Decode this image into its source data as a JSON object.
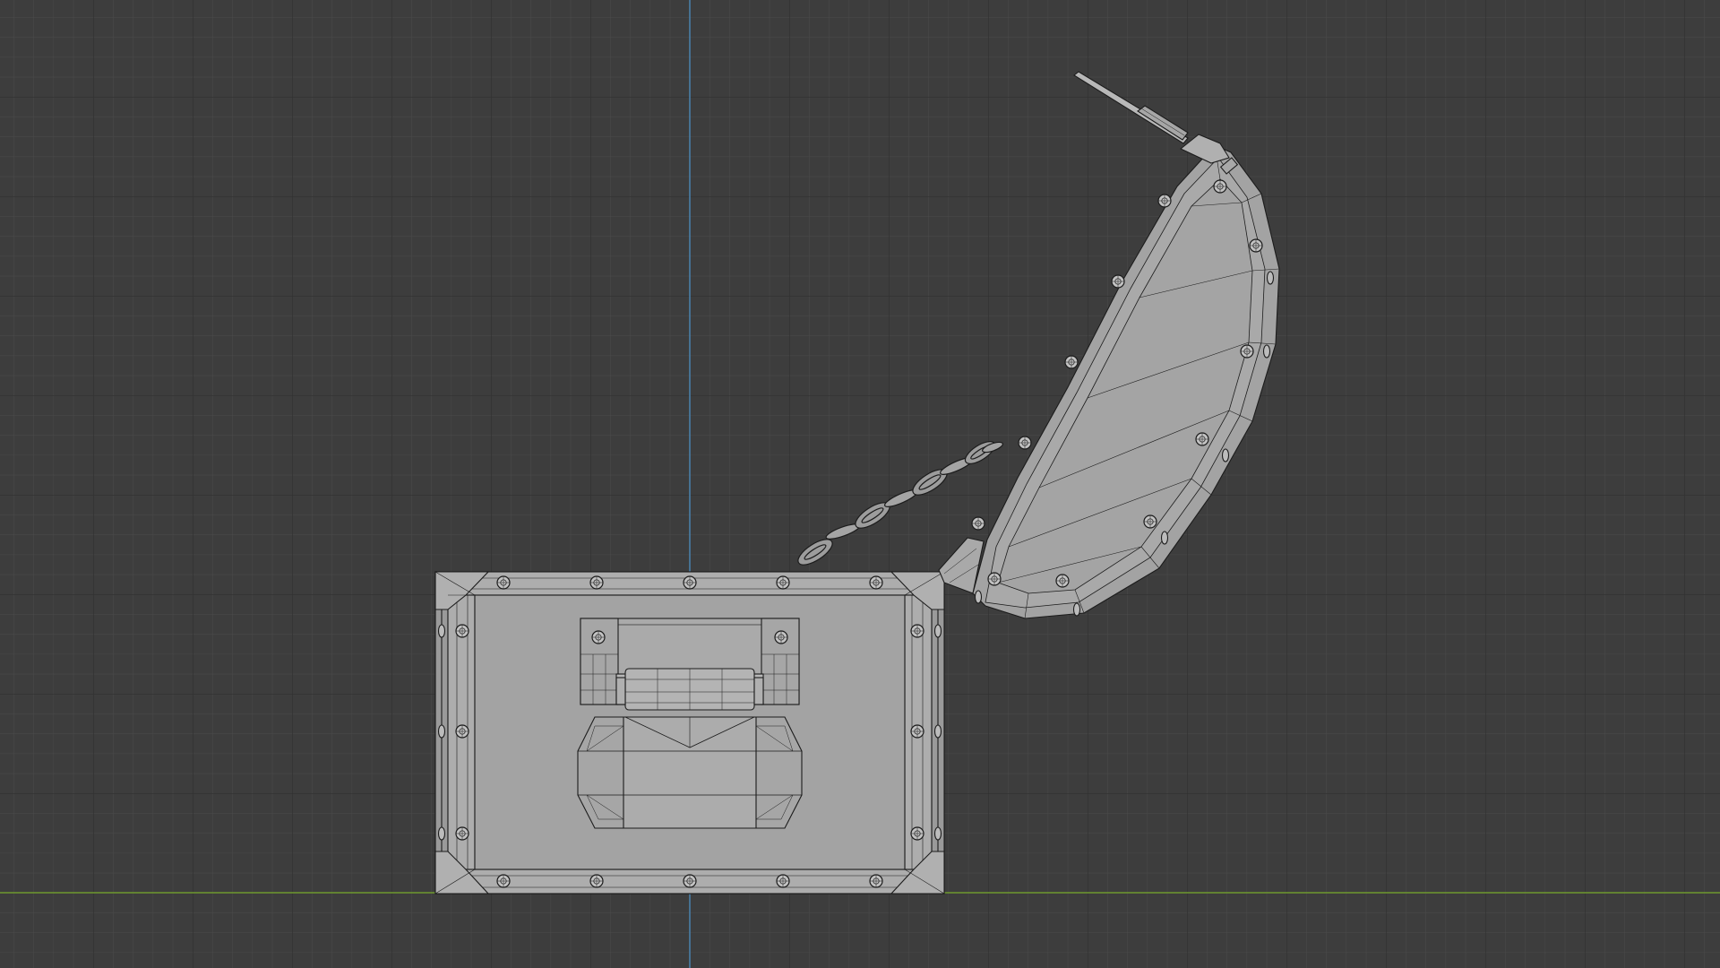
{
  "viewport": {
    "view": "front-orthographic",
    "mode": "wireframe-overlay",
    "object": "treasure-chest-open"
  },
  "colors": {
    "background": "#3d3d3d",
    "grid_minor": "#4a4a4a",
    "grid_major": "#2f2f2f",
    "axis_x": "#6f9a2e",
    "axis_z": "#4a7fa8",
    "mesh_fill": "#a3a3a3",
    "mesh_fill_light": "#b3b3b3",
    "wire": "#1c1c1c"
  }
}
